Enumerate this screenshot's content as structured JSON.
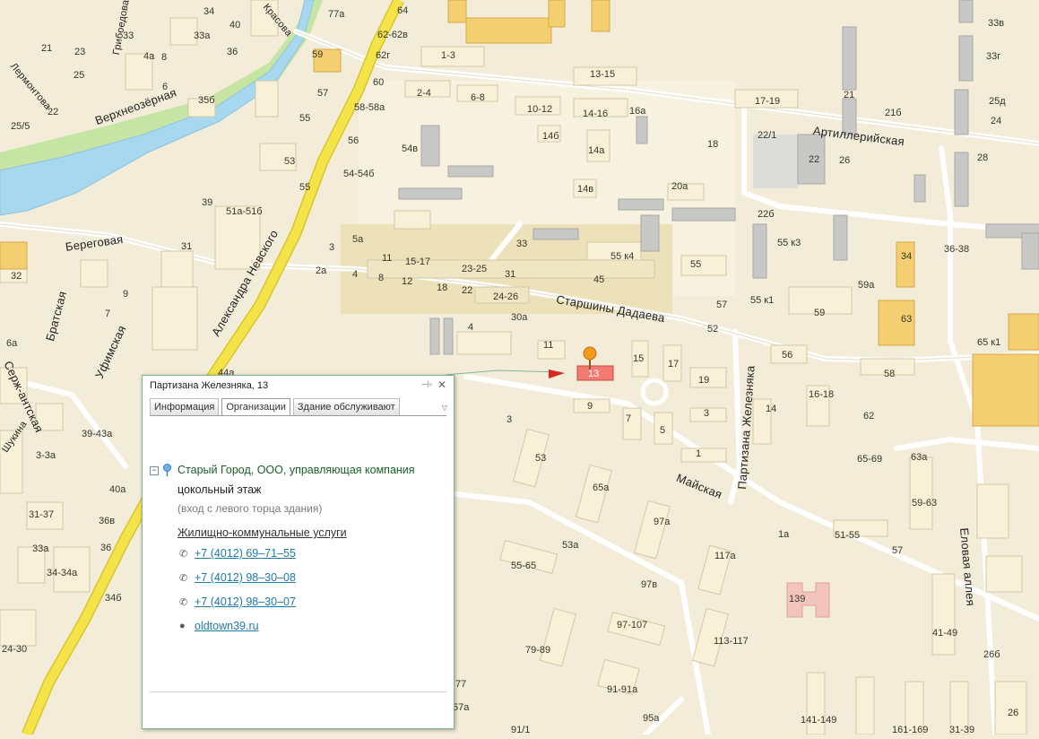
{
  "map": {
    "streets": [
      {
        "name": "Артиллерийская"
      },
      {
        "name": "Старшины Дадаева"
      },
      {
        "name": "Майская"
      },
      {
        "name": "Партизана Железняка"
      },
      {
        "name": "Александра Невского"
      },
      {
        "name": "Береговая"
      },
      {
        "name": "Уфимская"
      },
      {
        "name": "Братская"
      },
      {
        "name": "Серж-антская"
      },
      {
        "name": "Еловая аллея"
      },
      {
        "name": "Верхнеозёрная"
      },
      {
        "name": "Лермонтова"
      },
      {
        "name": "Грибоедова"
      },
      {
        "name": "Красова"
      },
      {
        "name": "Шукина"
      }
    ],
    "house_numbers": [
      "77а",
      "64",
      "62-62в",
      "62г",
      "59",
      "60",
      "58-58а",
      "57",
      "55",
      "56",
      "54в",
      "54-54б",
      "53",
      "55",
      "51а-51б",
      "39",
      "5а",
      "3",
      "2а",
      "4",
      "8",
      "12",
      "11",
      "15-17",
      "18",
      "22",
      "23-25",
      "31",
      "24-26",
      "30а",
      "33",
      "1-3",
      "2-4",
      "6-8",
      "10-12",
      "13-15",
      "14-16",
      "16а",
      "14б",
      "14а",
      "14в",
      "18",
      "17-19",
      "20а",
      "22б",
      "22/1",
      "22",
      "26",
      "21",
      "21б",
      "28",
      "33в",
      "33г",
      "25д",
      "24",
      "55 к3",
      "55 к4",
      "55",
      "55 к1",
      "57",
      "59а",
      "59",
      "34",
      "63",
      "36-38",
      "65 к1",
      "45",
      "52",
      "56",
      "58",
      "62",
      "4",
      "11",
      "13",
      "15",
      "17",
      "19",
      "16-18",
      "14",
      "9",
      "7",
      "5",
      "3",
      "1",
      "3",
      "53",
      "65а",
      "97а",
      "53а",
      "55-65",
      "97в",
      "97-107",
      "79-89",
      "91-91а",
      "95а",
      "91/1",
      "113-117",
      "117а",
      "139",
      "1а",
      "51-55",
      "57",
      "65-69",
      "63а",
      "59-63",
      "41-49",
      "26б",
      "141-149",
      "161-169",
      "31-39",
      "26",
      "36",
      "40",
      "31",
      "21",
      "25",
      "23",
      "22",
      "25/5",
      "34",
      "33а",
      "33",
      "35б",
      "4а",
      "6",
      "8",
      "32",
      "9",
      "7",
      "6а",
      "39-43а",
      "3-3а",
      "40а",
      "36в",
      "36",
      "34б",
      "24-30",
      "31-37",
      "33а",
      "34-34а",
      "77",
      "57а",
      "44а"
    ],
    "selected_building": "13"
  },
  "popup": {
    "title": "Партизана Железняка, 13",
    "tabs": [
      {
        "label": "Информация",
        "active": false
      },
      {
        "label": "Организации",
        "active": true
      },
      {
        "label": "Здание обслуживают",
        "active": false
      }
    ],
    "organization": {
      "name": "Старый Город, ООО, управляющая компания",
      "floor": "цокольный этаж",
      "entrance": "(вход с левого торца здания)",
      "category": "Жилищно-коммунальные услуги",
      "phones": [
        "+7 (4012) 69–71–55",
        "+7 (4012) 98–30–08",
        "+7 (4012) 98–30–07"
      ],
      "website": "oldtown39.ru"
    }
  },
  "colors": {
    "background": "#f3ecd9",
    "building": "#f8f1d8",
    "building_gray": "#c6c6c6",
    "main_road": "#f5e34a",
    "water": "#a8d8ef",
    "park": "#c6e5a4",
    "link": "#1e7aa8",
    "org_name": "#1a5f2a",
    "popup_border": "#7fb891"
  }
}
